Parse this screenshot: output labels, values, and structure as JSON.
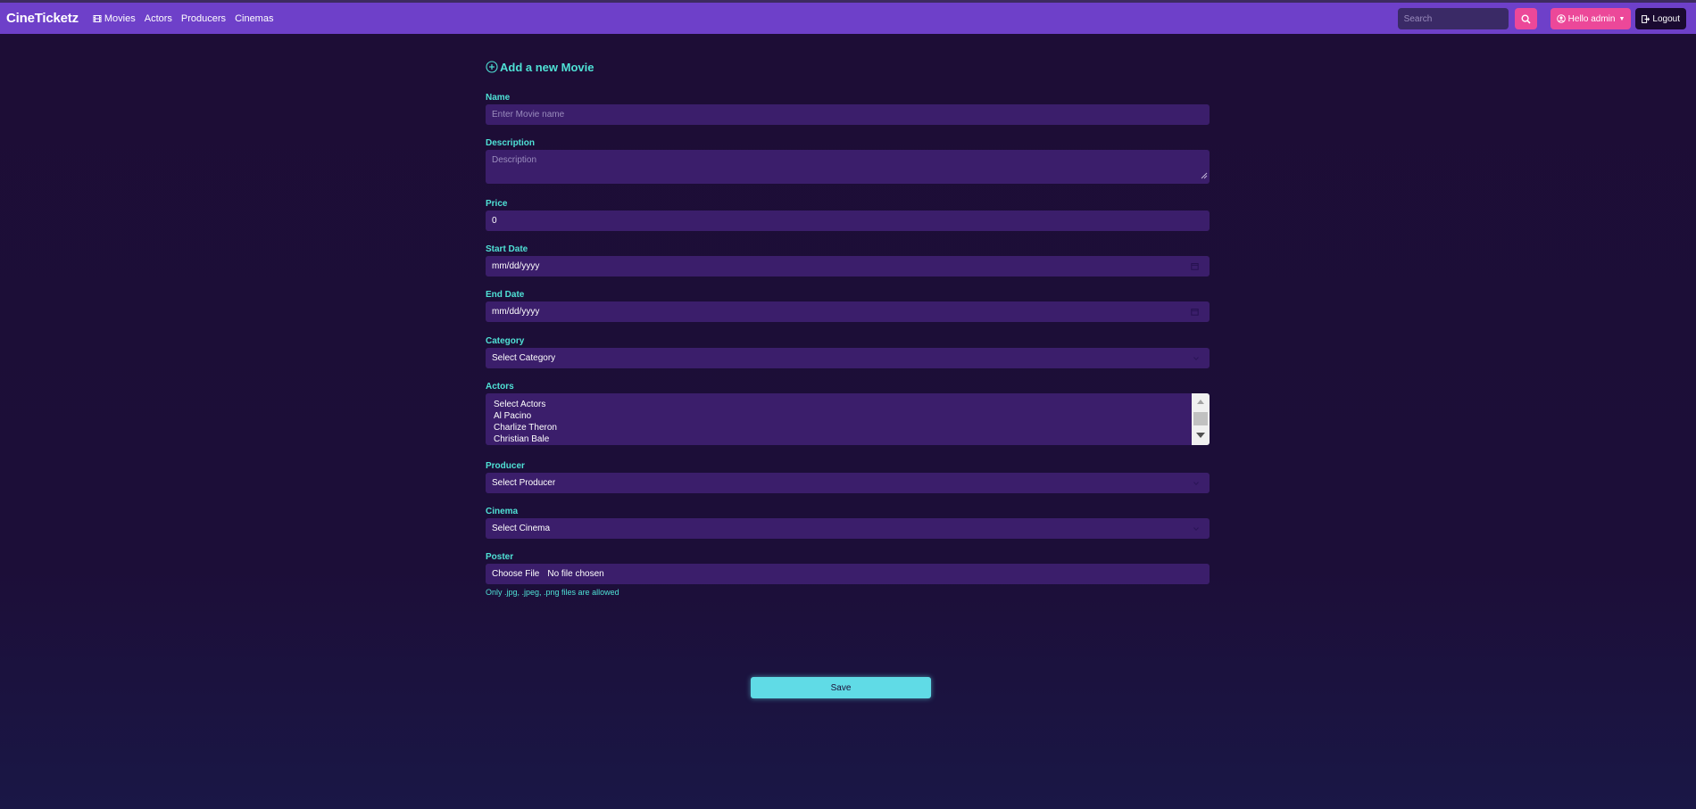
{
  "brand": "CineTicketz",
  "nav": {
    "movies": "Movies",
    "actors": "Actors",
    "producers": "Producers",
    "cinemas": "Cinemas"
  },
  "search": {
    "placeholder": "Search"
  },
  "user": {
    "greeting": "Hello admin",
    "logout": "Logout"
  },
  "form": {
    "title": "Add a new Movie",
    "name": {
      "label": "Name",
      "placeholder": "Enter Movie name"
    },
    "description": {
      "label": "Description",
      "placeholder": "Description"
    },
    "price": {
      "label": "Price",
      "value": "0"
    },
    "start_date": {
      "label": "Start Date",
      "value": "mm/dd/yyyy"
    },
    "end_date": {
      "label": "End Date",
      "value": "mm/dd/yyyy"
    },
    "category": {
      "label": "Category",
      "selected": "Select Category"
    },
    "actors": {
      "label": "Actors",
      "options": [
        "Select Actors",
        "Al Pacino",
        "Charlize Theron",
        "Christian Bale"
      ]
    },
    "producer": {
      "label": "Producer",
      "selected": "Select Producer"
    },
    "cinema": {
      "label": "Cinema",
      "selected": "Select Cinema"
    },
    "poster": {
      "label": "Poster",
      "button": "Choose File",
      "file": "No file chosen",
      "help": "Only .jpg, .jpeg, .png files are allowed"
    },
    "save": "Save"
  },
  "colors": {
    "navbar": "#6e40c9",
    "accent": "#4fe1d5",
    "pink": "#ec4899",
    "input_bg": "#3b1e6b",
    "save": "#60dbe6"
  }
}
